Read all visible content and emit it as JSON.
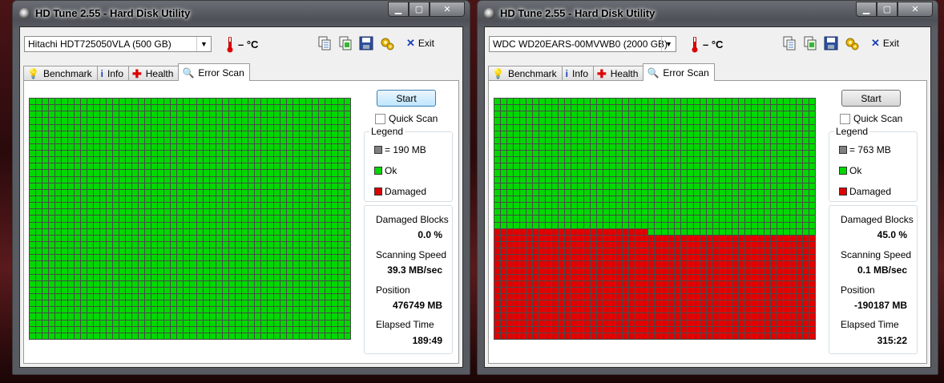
{
  "colors": {
    "ok": "#00d800",
    "damaged": "#e00000",
    "used": "#808080"
  },
  "windows": [
    {
      "title": "HD Tune 2.55 - Hard Disk Utility",
      "drive": "Hitachi HDT725050VLA (500 GB)",
      "temperature": "– °C",
      "exit_label": "Exit",
      "tabs": [
        "Benchmark",
        "Info",
        "Health",
        "Error Scan"
      ],
      "start_label": "Start",
      "quick_scan_label": "Quick Scan",
      "legend": {
        "title": "Legend",
        "block_size": "= 190 MB",
        "ok": "Ok",
        "damaged": "Damaged"
      },
      "stats": {
        "damaged_blocks_label": "Damaged Blocks",
        "damaged_blocks": "0.0 %",
        "speed_label": "Scanning Speed",
        "speed": "39.3 MB/sec",
        "position_label": "Position",
        "position": "476749 MB",
        "elapsed_label": "Elapsed Time",
        "elapsed": "189:49"
      },
      "scan": {
        "cols": 50,
        "rows": 37,
        "damaged_from_row": null,
        "damaged_from_col": null
      }
    },
    {
      "title": "HD Tune 2.55 - Hard Disk Utility",
      "drive": "WDC WD20EARS-00MVWB0 (2000 GB)",
      "temperature": "– °C",
      "exit_label": "Exit",
      "tabs": [
        "Benchmark",
        "Info",
        "Health",
        "Error Scan"
      ],
      "start_label": "Start",
      "quick_scan_label": "Quick Scan",
      "legend": {
        "title": "Legend",
        "block_size": "= 763 MB",
        "ok": "Ok",
        "damaged": "Damaged"
      },
      "stats": {
        "damaged_blocks_label": "Damaged Blocks",
        "damaged_blocks": "45.0 %",
        "speed_label": "Scanning Speed",
        "speed": "0.1 MB/sec",
        "position_label": "Position",
        "position": "-190187 MB",
        "elapsed_label": "Elapsed Time",
        "elapsed": "315:22"
      },
      "scan": {
        "cols": 50,
        "rows": 37,
        "damaged_from_row": 20,
        "damaged_from_col": 24
      }
    }
  ]
}
